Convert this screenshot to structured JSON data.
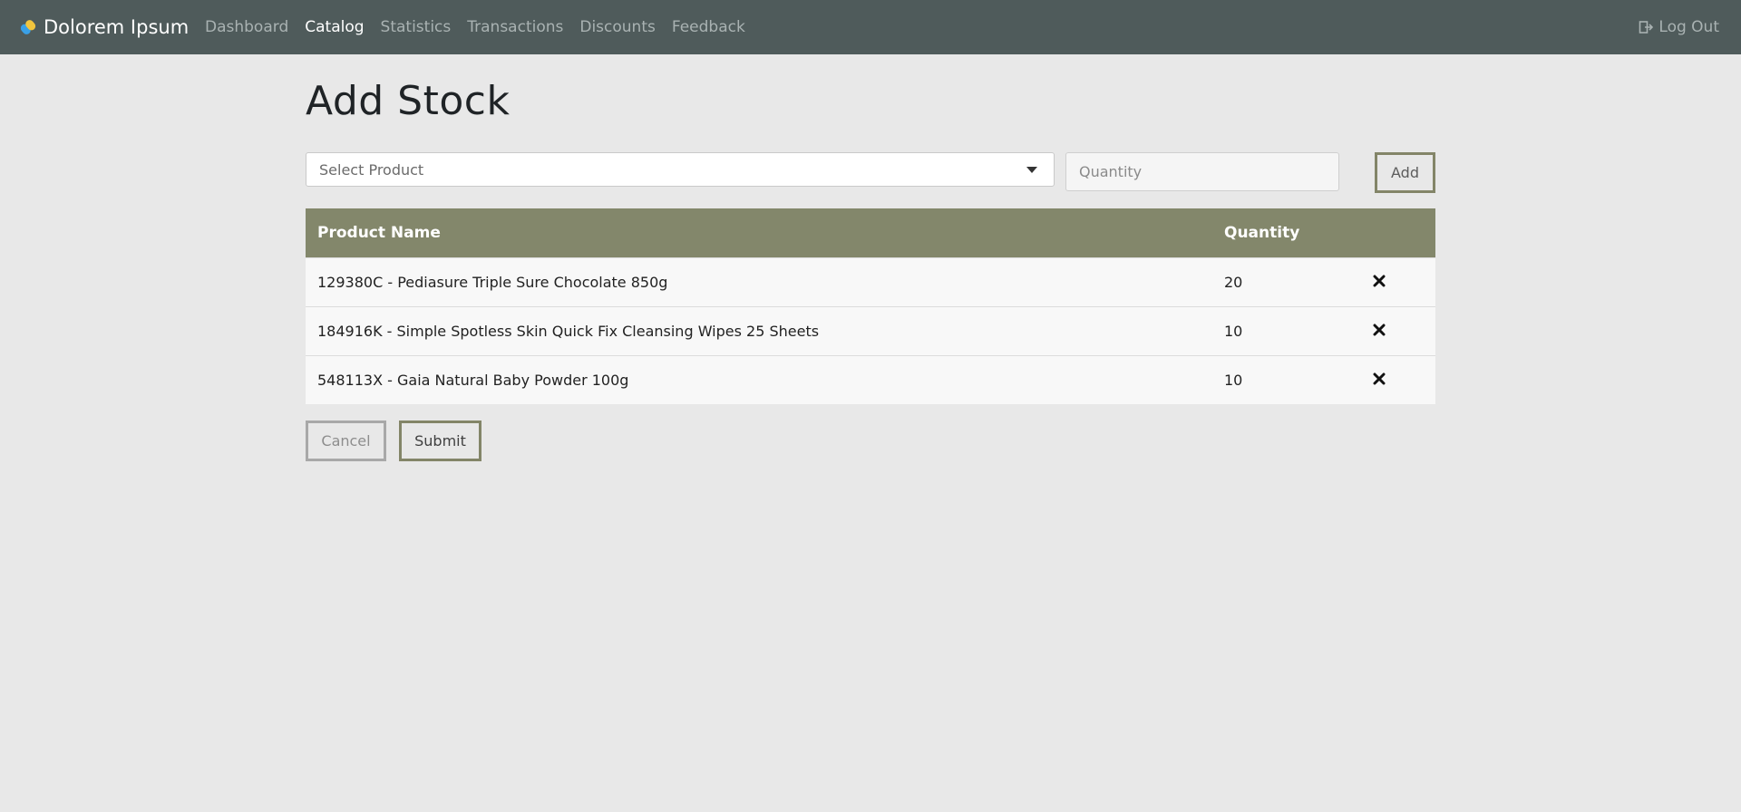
{
  "brand": {
    "name": "Dolorem Ipsum"
  },
  "nav": {
    "items": [
      {
        "label": "Dashboard",
        "active": false
      },
      {
        "label": "Catalog",
        "active": true
      },
      {
        "label": "Statistics",
        "active": false
      },
      {
        "label": "Transactions",
        "active": false
      },
      {
        "label": "Discounts",
        "active": false
      },
      {
        "label": "Feedback",
        "active": false
      }
    ],
    "logout_label": "Log Out"
  },
  "page": {
    "title": "Add Stock"
  },
  "form": {
    "product_select": {
      "placeholder": "Select Product",
      "value": ""
    },
    "quantity_input": {
      "placeholder": "Quantity",
      "value": ""
    },
    "add_label": "Add"
  },
  "table": {
    "headers": {
      "product_name": "Product Name",
      "quantity": "Quantity"
    },
    "rows": [
      {
        "product": "129380C - Pediasure Triple Sure Chocolate 850g",
        "quantity": "20"
      },
      {
        "product": "184916K - Simple Spotless Skin Quick Fix Cleansing Wipes 25 Sheets",
        "quantity": "10"
      },
      {
        "product": "548113X - Gaia Natural Baby Powder 100g",
        "quantity": "10"
      }
    ]
  },
  "actions": {
    "cancel_label": "Cancel",
    "submit_label": "Submit"
  },
  "colors": {
    "navbar": "#4f5b5b",
    "table_header": "#83876b",
    "button_border": "#838568",
    "background": "#e8e8e8"
  },
  "icons": {
    "brand": "pill-logo-icon",
    "logout": "sign-out-icon",
    "delete": "close-icon",
    "select": "caret-down-icon"
  }
}
